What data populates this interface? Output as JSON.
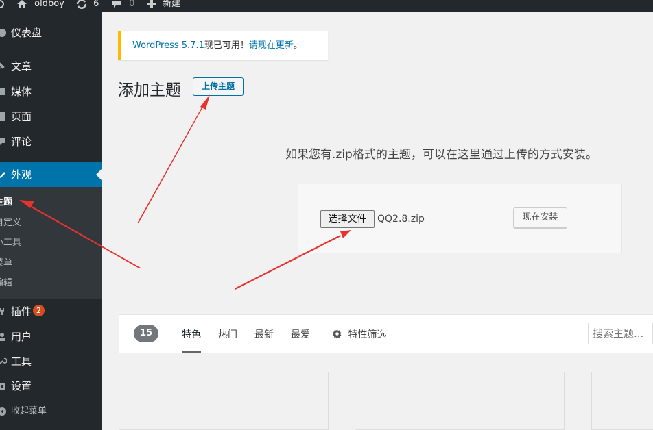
{
  "admin_bar": {
    "site_name": "oldboy",
    "updates_count": "6",
    "comments_count": "0",
    "new_label": "新建"
  },
  "sidebar": {
    "items": [
      {
        "label": "仪表盘",
        "icon": "dashboard-icon"
      },
      {
        "label": "文章",
        "icon": "pin-icon"
      },
      {
        "label": "媒体",
        "icon": "media-icon"
      },
      {
        "label": "页面",
        "icon": "page-icon"
      },
      {
        "label": "评论",
        "icon": "comment-icon"
      },
      {
        "label": "外观",
        "icon": "brush-icon"
      },
      {
        "label": "插件",
        "icon": "plugin-icon",
        "badge": "2"
      },
      {
        "label": "用户",
        "icon": "user-icon"
      },
      {
        "label": "工具",
        "icon": "wrench-icon"
      },
      {
        "label": "设置",
        "icon": "settings-icon"
      },
      {
        "label": "收起菜单",
        "icon": "collapse-icon"
      }
    ],
    "submenu": [
      "主题",
      "自定义",
      "小工具",
      "菜单",
      "编辑"
    ]
  },
  "notice": {
    "link_version": "WordPress 5.7.1",
    "text": "现已可用！",
    "link_update": "请现在更新",
    "period": "。"
  },
  "page": {
    "title": "添加主题",
    "upload_button": "上传主题",
    "help_text": "如果您有.zip格式的主题，可以在这里通过上传的方式安装。",
    "choose_file_button": "选择文件",
    "chosen_file": "QQ2.8.zip",
    "install_button": "现在安装"
  },
  "filter_bar": {
    "count": "15",
    "tabs": [
      "特色",
      "热门",
      "最新",
      "最爱"
    ],
    "feature_filter": "特性筛选",
    "search_placeholder": "搜索主题..."
  },
  "colors": {
    "sidebar_bg": "#23282d",
    "accent": "#0073aa",
    "notice_border": "#ffb900",
    "annotation_arrow": "#e8322f"
  }
}
